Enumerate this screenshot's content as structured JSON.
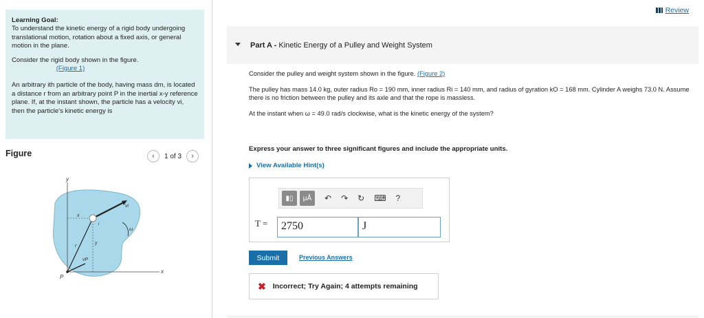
{
  "learning_goal": {
    "heading": "Learning Goal:",
    "text": "To understand the kinetic energy of a rigid body undergoing translational motion, rotation about a fixed axis, or general motion in the plane.",
    "consider": "Consider the rigid body shown in the figure.",
    "figure_link": "(Figure 1)",
    "particle_text": "An arbitrary ith particle of the body, having mass dm, is located a distance r from an arbitrary point P in the inertial x-y reference plane. If, at the instant shown, the particle has a velocity vi, then the particle's kinetic energy is"
  },
  "figure_panel": {
    "heading": "Figure",
    "pager": "1 of 3",
    "labels": {
      "y_axis": "y",
      "x_axis": "x",
      "point_p": "P",
      "vi": "vi",
      "omega": "ω",
      "r": "r",
      "x": "x",
      "y": "y",
      "vp": "vP",
      "i": "i"
    }
  },
  "review": "Review",
  "part": {
    "label": "Part A -",
    "title": "Kinetic Energy of a Pulley and Weight System"
  },
  "problem": {
    "p1": "Consider the pulley and weight system shown in the figure.",
    "p1_link": "(Figure 2)",
    "p2": "The pulley has mass 14.0 kg, outer radius Ro = 190 mm, inner radius Ri = 140 mm, and radius of gyration kO = 168 mm. Cylinder A weighs 73.0 N. Assume there is no friction between the pulley and its axle and that the rope is massless.",
    "p3": "At the instant when ω = 49.0 rad/s clockwise, what is the kinetic energy of the system?"
  },
  "instructions": "Express your answer to three significant figures and include the appropriate units.",
  "hints_label": "View Available Hint(s)",
  "answer": {
    "variable": "T =",
    "value": "2750",
    "units": "J",
    "toolbar": {
      "mu_a": "μÅ",
      "help": "?"
    }
  },
  "submit_label": "Submit",
  "previous_answers": "Previous Answers",
  "feedback": "Incorrect; Try Again; 4 attempts remaining"
}
